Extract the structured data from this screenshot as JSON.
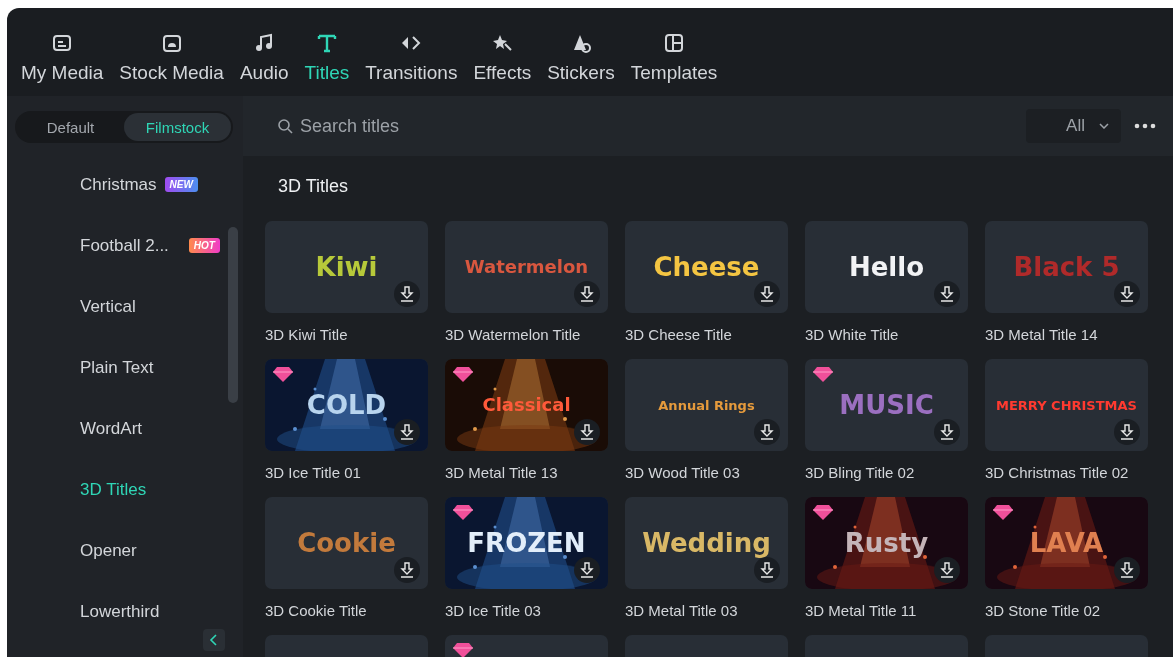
{
  "tabs": [
    {
      "label": "My Media",
      "selected": false
    },
    {
      "label": "Stock Media",
      "selected": false
    },
    {
      "label": "Audio",
      "selected": false
    },
    {
      "label": "Titles",
      "selected": true
    },
    {
      "label": "Transitions",
      "selected": false
    },
    {
      "label": "Effects",
      "selected": false
    },
    {
      "label": "Stickers",
      "selected": false
    },
    {
      "label": "Templates",
      "selected": false
    }
  ],
  "source_toggle": [
    {
      "label": "Default",
      "selected": false
    },
    {
      "label": "Filmstock",
      "selected": true
    }
  ],
  "search": {
    "placeholder": "Search titles"
  },
  "filter": {
    "value": "All"
  },
  "sidebar": {
    "items": [
      {
        "label": "Christmas",
        "badge": {
          "text": "NEW",
          "kind": "new"
        },
        "selected": false
      },
      {
        "label": "Football 2...",
        "badge": {
          "text": "HOT",
          "kind": "hot"
        },
        "selected": false
      },
      {
        "label": "Vertical",
        "selected": false
      },
      {
        "label": "Plain Text",
        "selected": false
      },
      {
        "label": "WordArt",
        "selected": false
      },
      {
        "label": "3D Titles",
        "selected": true
      },
      {
        "label": "Opener",
        "selected": false
      },
      {
        "label": "Lowerthird",
        "selected": false
      }
    ]
  },
  "section_title": "3D Titles",
  "cards": [
    {
      "preview": "Kiwi",
      "name": "3D Kiwi Title",
      "kind": "plain",
      "premium": false
    },
    {
      "preview": "Watermelon",
      "name": "3D Watermelon Title",
      "kind": "plain",
      "premium": false
    },
    {
      "preview": "Cheese",
      "name": "3D Cheese Title",
      "kind": "plain",
      "premium": false
    },
    {
      "preview": "Hello",
      "name": "3D White Title",
      "kind": "plain",
      "premium": false
    },
    {
      "preview": "Black 5",
      "name": "3D Metal Title 14",
      "kind": "plain",
      "premium": false
    },
    {
      "preview": "COLD",
      "name": "3D Ice Title 01",
      "kind": "blue-photo",
      "premium": true
    },
    {
      "preview": "Classical",
      "name": "3D Metal Title 13",
      "kind": "amber-photo",
      "premium": true
    },
    {
      "preview": "Annual Rings",
      "name": "3D Wood Title 03",
      "kind": "plain",
      "premium": false
    },
    {
      "preview": "MUSIC",
      "name": "3D Bling Title 02",
      "kind": "plain",
      "premium": true
    },
    {
      "preview": "MERRY CHRISTMAS",
      "name": "3D Christmas Title 02",
      "kind": "plain",
      "premium": false
    },
    {
      "preview": "Cookie",
      "name": "3D Cookie Title",
      "kind": "plain",
      "premium": false
    },
    {
      "preview": "FROZEN",
      "name": "3D Ice Title 03",
      "kind": "blue-photo",
      "premium": true
    },
    {
      "preview": "Wedding",
      "name": "3D Metal Title 03",
      "kind": "plain",
      "premium": false
    },
    {
      "preview": "Rusty",
      "name": "3D Metal Title 11",
      "kind": "red-photo",
      "premium": true
    },
    {
      "preview": "LAVA",
      "name": "3D Stone Title 02",
      "kind": "red-photo",
      "premium": true
    },
    {
      "kind": "plain",
      "premium": false
    },
    {
      "kind": "plain",
      "premium": true
    },
    {
      "kind": "plain",
      "premium": false
    },
    {
      "kind": "plain",
      "premium": false
    },
    {
      "kind": "plain",
      "premium": false
    }
  ]
}
